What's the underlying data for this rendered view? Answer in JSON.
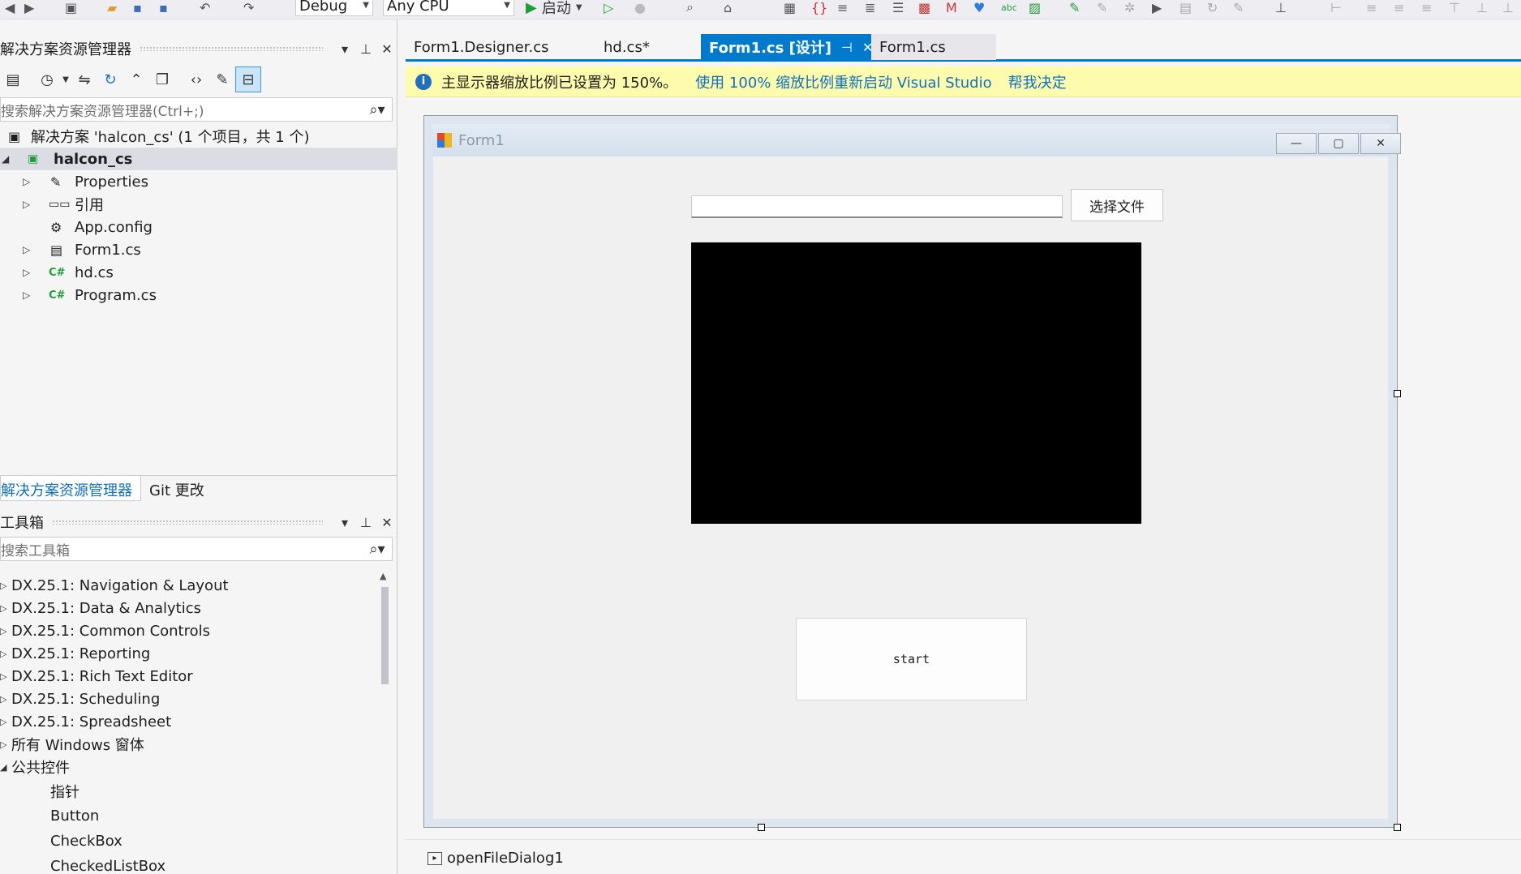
{
  "toolbar": {
    "config_combo": "Debug",
    "platform_combo": "Any CPU",
    "start_label": "启动"
  },
  "solution_explorer": {
    "title": "解决方案资源管理器",
    "search_placeholder": "搜索解决方案资源管理器(Ctrl+;)",
    "solution_label": "解决方案 'halcon_cs' (1 个项目，共 1 个)",
    "project_label": "halcon_cs",
    "items": [
      {
        "label": "Properties",
        "icon": "wrench-icon"
      },
      {
        "label": "引用",
        "icon": "references-icon"
      },
      {
        "label": "App.config",
        "icon": "config-file-icon"
      },
      {
        "label": "Form1.cs",
        "icon": "form-file-icon"
      },
      {
        "label": "hd.cs",
        "icon": "csharp-file-icon"
      },
      {
        "label": "Program.cs",
        "icon": "csharp-file-icon"
      }
    ],
    "tabs": [
      "解决方案资源管理器",
      "Git 更改"
    ]
  },
  "toolbox": {
    "title": "工具箱",
    "search_placeholder": "搜索工具箱",
    "groups": [
      "DX.25.1: Navigation & Layout",
      "DX.25.1: Data & Analytics",
      "DX.25.1: Common Controls",
      "DX.25.1: Reporting",
      "DX.25.1: Rich Text Editor",
      "DX.25.1: Scheduling",
      "DX.25.1: Spreadsheet",
      "所有 Windows 窗体",
      "公共控件"
    ],
    "children": [
      "指针",
      "Button",
      "CheckBox",
      "CheckedListBox"
    ]
  },
  "doc_tabs": [
    {
      "label": "Form1.Designer.cs"
    },
    {
      "label": "hd.cs*"
    },
    {
      "label": "Form1.cs [设计]"
    },
    {
      "label": "Form1.cs"
    }
  ],
  "infobar": {
    "message": "主显示器缩放比例已设置为 150%。",
    "link1": "使用 100% 缩放比例重新启动 Visual Studio",
    "link2": "帮我决定"
  },
  "form": {
    "title": "Form1",
    "choose_file_button": "选择文件",
    "file_path_value": "",
    "start_button": "start"
  },
  "component_tray": {
    "item": "openFileDialog1"
  },
  "colors": {
    "accent": "#007acc",
    "infobar_bg": "#fdfbac",
    "link": "#0e70c0"
  }
}
